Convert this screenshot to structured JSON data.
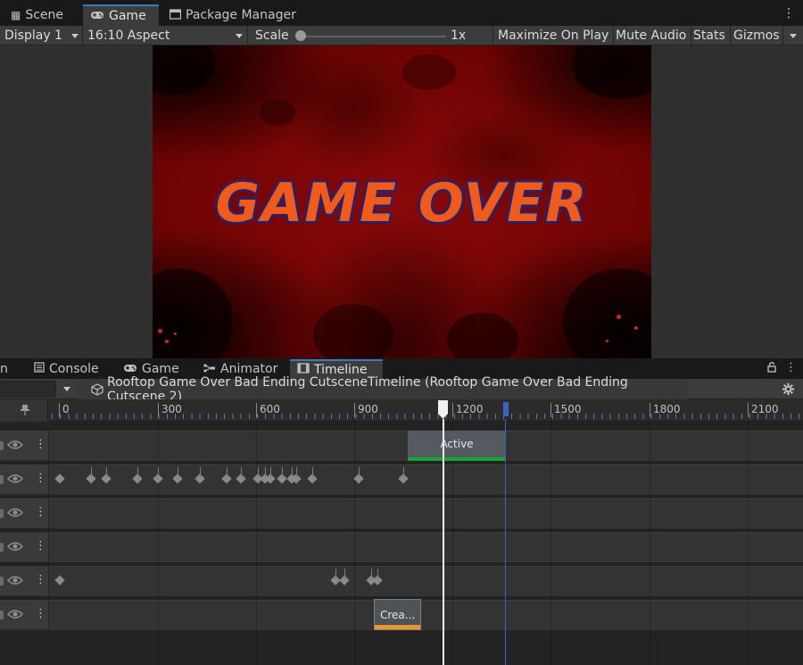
{
  "top_tabs": [
    {
      "label": "Scene",
      "icon": "grid-icon"
    },
    {
      "label": "Game",
      "icon": "gamepad-icon"
    },
    {
      "label": "Package Manager",
      "icon": "package-icon"
    }
  ],
  "game_toolbar": {
    "display": "Display 1",
    "aspect": "16:10 Aspect",
    "scale_label": "Scale",
    "scale_value": "1x",
    "maximize_on_play": "Maximize On Play",
    "mute_audio": "Mute Audio",
    "stats": "Stats",
    "gizmos": "Gizmos"
  },
  "game_screen": {
    "text": "GAME OVER",
    "colors": {
      "background": "#7a0505",
      "text": "#f05a1c",
      "outline": "#2e2060"
    }
  },
  "bottom_tabs": [
    {
      "label": "n",
      "icon": ""
    },
    {
      "label": "Console",
      "icon": "console-icon"
    },
    {
      "label": "Game",
      "icon": "gamepad-icon"
    },
    {
      "label": "Animator",
      "icon": "animator-icon"
    },
    {
      "label": "Timeline",
      "icon": "film-icon"
    }
  ],
  "timeline": {
    "breadcrumb": "Rooftop Game Over Bad Ending CutsceneTimeline (Rooftop Game Over Bad Ending Cutscene 2)",
    "ruler_ticks": [
      "0",
      "300",
      "600",
      "900",
      "1200",
      "1500",
      "1800",
      "2100"
    ],
    "clips": {
      "active_label": "Active",
      "crea_label": "Crea..."
    },
    "colors": {
      "playhead": "#f2f2f2",
      "end_marker": "#3a64c0",
      "activation": "#18a334",
      "clip_accent": "#e8972a"
    }
  }
}
